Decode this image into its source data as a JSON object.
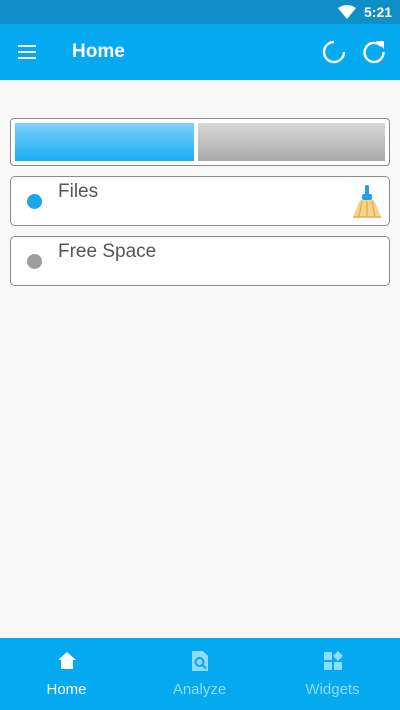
{
  "status_bar": {
    "time": "5:21",
    "wifi_icon": "wifi-icon"
  },
  "app_bar": {
    "title": "Home",
    "menu_icon": "menu-icon",
    "spinner_icon": "loading-icon",
    "refresh_icon": "refresh-icon"
  },
  "storage": {
    "used_fraction": 0.49,
    "used_color": "#18aef2",
    "free_color": "#b5b5b5"
  },
  "legend": [
    {
      "label": "Files",
      "color": "#1da6e8",
      "action_icon": "broom-clean-icon"
    },
    {
      "label": "Free Space",
      "color": "#9e9e9e"
    }
  ],
  "bottom_nav": [
    {
      "label": "Home",
      "icon": "home-icon",
      "active": true
    },
    {
      "label": "Analyze",
      "icon": "analyze-search-icon",
      "active": false
    },
    {
      "label": "Widgets",
      "icon": "widgets-icon",
      "active": false
    }
  ],
  "colors": {
    "primary": "#05a9ef",
    "status_bar": "#0e8fc8",
    "inactive_nav": "#8fdcff"
  }
}
